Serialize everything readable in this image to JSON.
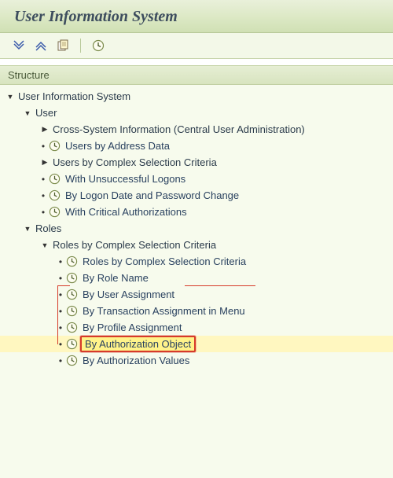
{
  "title": "User Information System",
  "structure_label": "Structure",
  "tree": {
    "root": "User Information System",
    "user": "User",
    "cross_system": "Cross-System Information (Central User Administration)",
    "users_by_address": "Users by Address Data",
    "users_by_complex": "Users by Complex Selection Criteria",
    "unsuccessful_logons": "With Unsuccessful Logons",
    "logon_date_pwd": "By Logon Date and Password Change",
    "critical_auth": "With Critical Authorizations",
    "roles": "Roles",
    "roles_by_complex": "Roles by Complex Selection Criteria",
    "roles_by_complex_item": "Roles by Complex Selection Criteria",
    "by_role_name": "By Role Name",
    "by_user_assignment": "By User Assignment",
    "by_transaction": "By Transaction Assignment in Menu",
    "by_profile": "By Profile Assignment",
    "by_auth_object": "By Authorization Object",
    "by_auth_values": "By Authorization Values"
  }
}
